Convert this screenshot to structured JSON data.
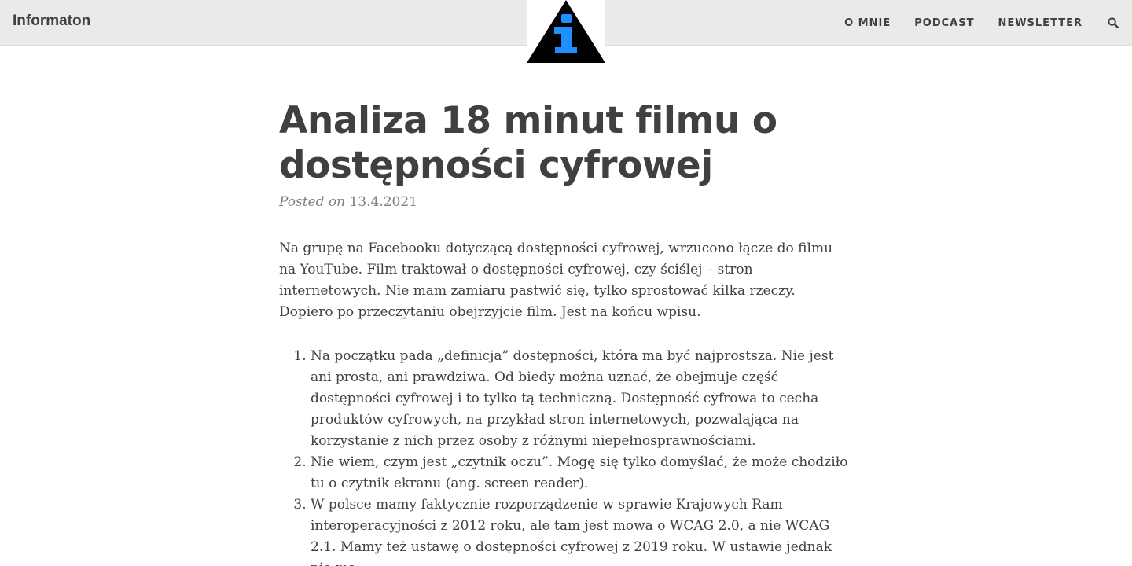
{
  "site": {
    "brand": "Informaton"
  },
  "nav": {
    "items": [
      {
        "label": "O MNIE"
      },
      {
        "label": "PODCAST"
      },
      {
        "label": "NEWSLETTER"
      }
    ],
    "search_icon": "search-icon"
  },
  "logo": {
    "icon": "info-triangle-icon",
    "colors": {
      "triangle": "#000000",
      "letter": "#1e90ff"
    }
  },
  "article": {
    "title": "Analiza 18 minut filmu o dostępności cyfrowej",
    "meta_prefix": "Posted on",
    "date": "13.4.2021",
    "intro": "Na grupę na Facebooku dotyczącą dostępności cyfrowej, wrzucono łącze do filmu na YouTube. Film traktował o dostępności cyfrowej, czy ściślej – stron internetowych. Nie mam zamiaru pastwić się, tylko sprostować kilka rzeczy. Dopiero po przeczytaniu obejrzyjcie film. Jest na końcu wpisu.",
    "list": [
      "Na początku pada „definicja” dostępności, która ma być najprostsza. Nie jest ani prosta, ani prawdziwa. Od biedy można uznać, że obejmuje część dostępności cyfrowej i to tylko tą techniczną. Dostępność cyfrowa to cecha produktów cyfrowych, na przykład stron internetowych, pozwalająca na korzystanie z nich przez osoby z różnymi niepełnosprawnościami.",
      "Nie wiem, czym jest „czytnik oczu”. Mogę się tylko domyślać, że może chodziło tu o czytnik ekranu (ang. screen reader).",
      "W polsce mamy faktycznie rozporządzenie w sprawie Krajowych Ram interoperacyjności z 2012 roku, ale tam jest mowa o WCAG 2.0, a nie WCAG 2.1. Mamy też ustawę o dostępności cyfrowej z 2019 roku. W ustawie jednak nie ma"
    ]
  }
}
